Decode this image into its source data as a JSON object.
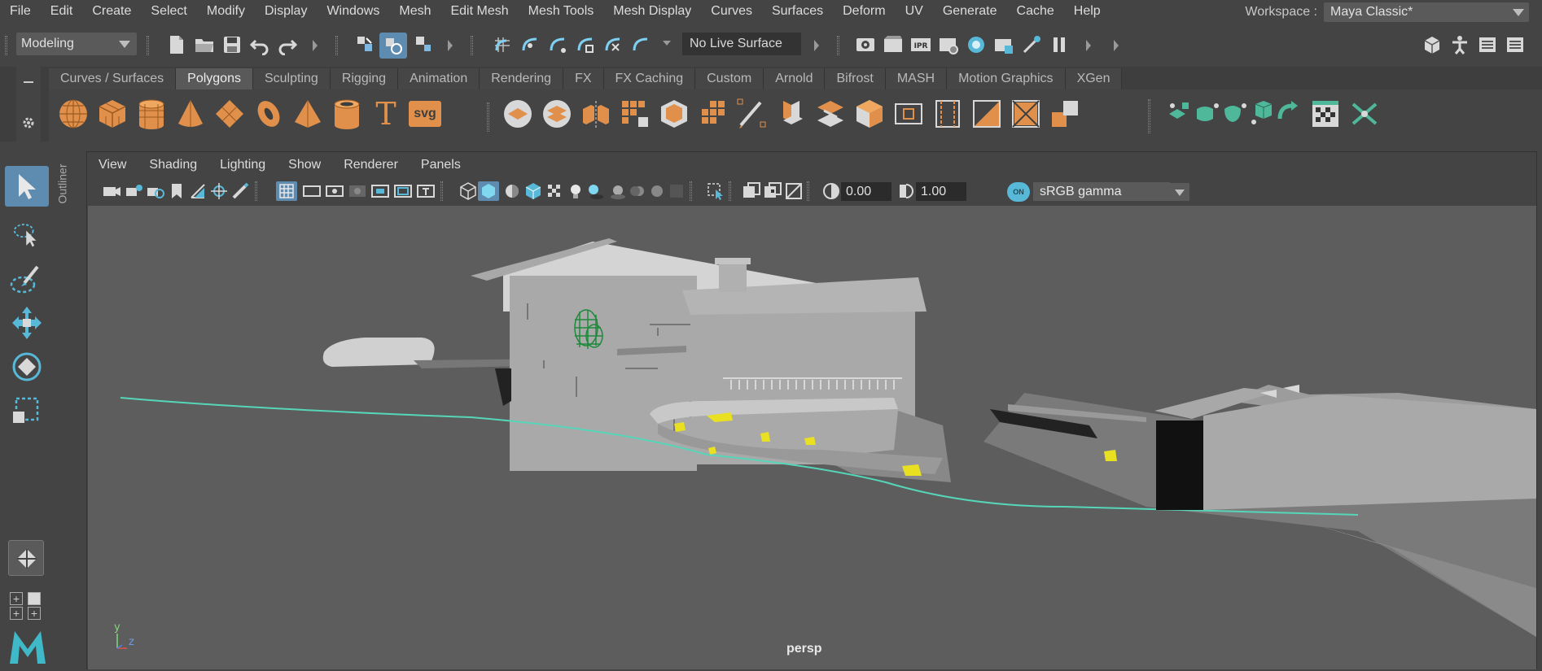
{
  "menubar": {
    "items": [
      "File",
      "Edit",
      "Create",
      "Select",
      "Modify",
      "Display",
      "Windows",
      "Mesh",
      "Edit Mesh",
      "Mesh Tools",
      "Mesh Display",
      "Curves",
      "Surfaces",
      "Deform",
      "UV",
      "Generate",
      "Cache",
      "Help"
    ],
    "workspace_label": "Workspace :",
    "workspace_value": "Maya Classic*"
  },
  "statusline": {
    "menuset": "Modeling",
    "live_surface": "No Live Surface"
  },
  "shelf": {
    "tabs": [
      "Curves / Surfaces",
      "Polygons",
      "Sculpting",
      "Rigging",
      "Animation",
      "Rendering",
      "FX",
      "FX Caching",
      "Custom",
      "Arnold",
      "Bifrost",
      "MASH",
      "Motion Graphics",
      "XGen"
    ],
    "active_tab": "Polygons",
    "text_icon": "T",
    "svg_icon": "svg",
    "accent_color": "#e0904a",
    "teal_color": "#4fb89a"
  },
  "outliner": {
    "label": "Outliner"
  },
  "panel": {
    "menus": [
      "View",
      "Shading",
      "Lighting",
      "Show",
      "Renderer",
      "Panels"
    ],
    "exposure": "0.00",
    "gamma": "1.00",
    "color_toggle": "ON",
    "color_space": "sRGB gamma"
  },
  "viewport": {
    "camera_label": "persp",
    "axis_y": "y",
    "axis_z": "z"
  },
  "ipr_label": "IPR"
}
